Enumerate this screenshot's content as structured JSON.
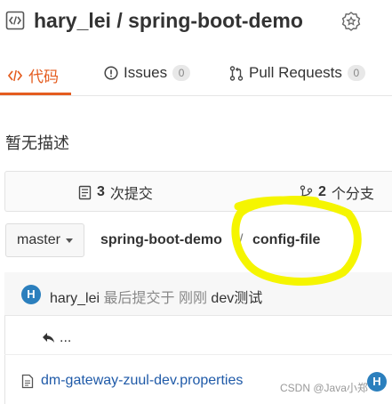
{
  "header": {
    "repo_title": "hary_lei / spring-boot-demo",
    "repo_icon": "repo-code-icon",
    "badge_icon": "certified-badge-icon"
  },
  "tabs": {
    "code": {
      "label": "代码",
      "icon": "code-icon"
    },
    "issues": {
      "label": "Issues",
      "count": "0",
      "icon": "info-circle-icon"
    },
    "pull_requests": {
      "label": "Pull Requests",
      "count": "0",
      "icon": "pull-request-icon"
    }
  },
  "description": "暂无描述",
  "stats": {
    "commits_count": "3",
    "commits_label": "次提交",
    "branches_count": "2",
    "branches_label": "个分支"
  },
  "branch": {
    "name": "master",
    "breadcrumb_repo": "spring-boot-demo",
    "breadcrumb_sep": "/",
    "breadcrumb_dir": "config-file"
  },
  "last_commit": {
    "avatar_letter": "H",
    "author": "hary_lei",
    "action": "最后提交于",
    "time": "刚刚",
    "message": "dev测试"
  },
  "file_list": {
    "back_label": "...",
    "files": [
      {
        "name": "dm-gateway-zuul-dev.properties",
        "avatar_letter": "H"
      }
    ]
  },
  "watermark": "CSDN @Java小郑",
  "colors": {
    "accent": "#e45c1f",
    "link": "#1f5aa8",
    "avatar": "#2b7fbd",
    "highlight": "#f5f500"
  }
}
